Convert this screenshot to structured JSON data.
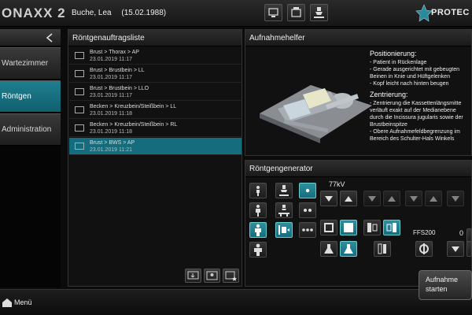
{
  "app": {
    "title": "ONAXX 2",
    "brand": "PROTEC",
    "brand_color": "#2a8a9a"
  },
  "patient": {
    "name": "Buche, Lea",
    "dob": "(15.02.1988)"
  },
  "sidebar": {
    "items": [
      {
        "label": "Wartezimmer",
        "active": false
      },
      {
        "label": "Röntgen",
        "active": true
      },
      {
        "label": "Administration",
        "active": false
      }
    ]
  },
  "orders": {
    "title": "Röntgenauftragsliste",
    "rows": [
      {
        "exam": "Brust > Thorax > AP",
        "date": "23.01.2019 11:17",
        "selected": false
      },
      {
        "exam": "Brust > Brustbein > LL",
        "date": "23.01.2019 11:17",
        "selected": false
      },
      {
        "exam": "Brust > Brustbein > LLO",
        "date": "23.01.2019 11:17",
        "selected": false
      },
      {
        "exam": "Becken > Kreuzbein/Steißbein > LL",
        "date": "23.01.2019 11:18",
        "selected": false
      },
      {
        "exam": "Becken > Kreuzbein/Steißbein > RL",
        "date": "23.01.2019 11:18",
        "selected": false
      },
      {
        "exam": "Brust > BWS > AP",
        "date": "23.01.2019 11:21",
        "selected": true
      }
    ]
  },
  "helper": {
    "title": "Aufnahmehelfer",
    "positioning_heading": "Positionierung:",
    "positioning_lines": [
      "- Patient in Rückenlage",
      "- Gerade ausgerichtet mit gebeugten Beinen in Knie und Hüftgelenken",
      "- Kopf leicht nach hinten beugen"
    ],
    "centering_heading": "Zentrierung:",
    "centering_lines": [
      "- Zentrierung die Kassettenlängsmitte verläuft exakt auf der Medianebene durch die Incissura jugularis sowie der Brustbeinspitze",
      "- Obere Aufnahmefeldbegrenzung im Bereich des Schulter-Hals Winkels"
    ]
  },
  "generator": {
    "title": "Röntgengenerator",
    "kv_value": "77kV",
    "focus_label": "FFS200",
    "mas_value": "0"
  },
  "footer": {
    "menu_label": "Menü",
    "start_button": "Aufnahme starten"
  },
  "colors": {
    "accent": "#156c7c",
    "active": "#1f7f8f"
  }
}
